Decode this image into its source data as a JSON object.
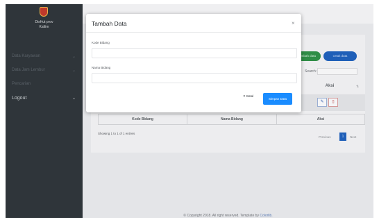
{
  "sidebar": {
    "brand_line1": "DisHut prov",
    "brand_line2": "Kaltim",
    "items": [
      {
        "label": "Data Karyawan",
        "active": false
      },
      {
        "label": "Data Jam Lembur",
        "active": false
      },
      {
        "label": "Pencarian",
        "active": false
      },
      {
        "label": "Logout",
        "active": true
      }
    ]
  },
  "main": {
    "btn_green_label": "+ tambah data",
    "btn_blue_label": "cetak data",
    "search_label": "Search:",
    "aksi_header": "Aksi",
    "table_footer": [
      "Kode Bidang",
      "Nama Bidang",
      "Aksi"
    ],
    "entries_text": "Showing 1 to 1 of 1 entries",
    "pager_prev": "Previous",
    "pager_page": "1",
    "pager_next": "Next",
    "footer_text": "© Copyright 2018. All right reserved. Template by ",
    "footer_link": "Colorlib."
  },
  "modal": {
    "title": "Tambah Data",
    "close_label": "×",
    "field1_label": "Kode Bidang",
    "field1_value": "",
    "field1_placeholder": "",
    "field2_label": "Nama Bidang",
    "field2_value": "",
    "field2_placeholder": "",
    "cancel_label": "✕ Batal",
    "save_label": "Simpan Data"
  },
  "colors": {
    "sidebar": "#2f353a",
    "primary": "#1a8cff",
    "green": "#2f8d46",
    "danger": "#b33a3a"
  }
}
